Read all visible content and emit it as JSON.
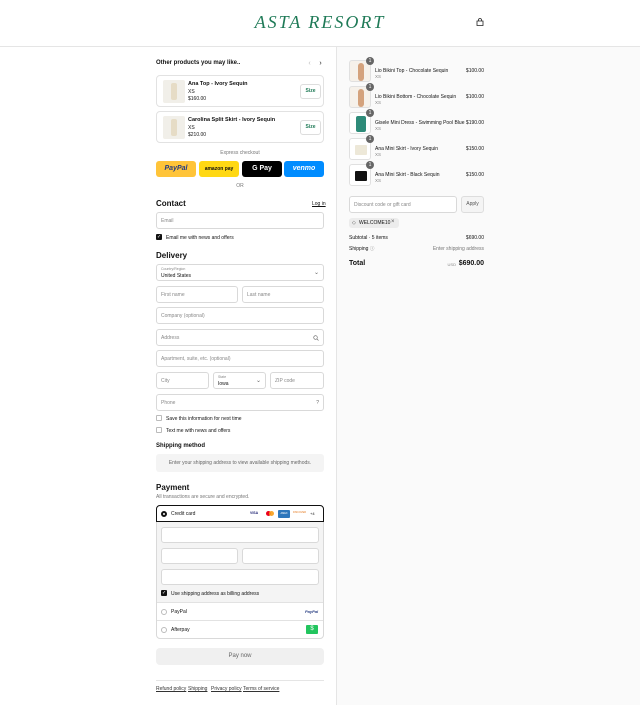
{
  "brand": "ASTA RESORT",
  "upsell": {
    "title": "Other products you may like..",
    "items": [
      {
        "name": "Ana Top - Ivory Sequin",
        "size": "XS",
        "price": "$160.00",
        "button": "Size"
      },
      {
        "name": "Carolina Split Skirt - Ivory Sequin",
        "size": "XS",
        "price": "$210.00",
        "button": "Size"
      }
    ]
  },
  "express": {
    "label": "Express checkout",
    "buttons": [
      "PayPal",
      "amazon pay",
      "G Pay",
      "venmo"
    ],
    "or": "OR"
  },
  "contact": {
    "title": "Contact",
    "login": "Log in",
    "email_placeholder": "Email",
    "newsletter": "Email me with news and offers"
  },
  "delivery": {
    "title": "Delivery",
    "country_label": "Country/Region",
    "country": "United States",
    "first_name": "First name",
    "last_name": "Last name",
    "company": "Company (optional)",
    "address": "Address",
    "apartment": "Apartment, suite, etc. (optional)",
    "city": "City",
    "state_label": "State",
    "state": "Iowa",
    "zip": "ZIP code",
    "phone": "Phone",
    "save_info": "Save this information for next time",
    "text_offers": "Text me with news and offers"
  },
  "shipping": {
    "title": "Shipping method",
    "message": "Enter your shipping address to view available shipping methods."
  },
  "payment": {
    "title": "Payment",
    "subtitle": "All transactions are secure and encrypted.",
    "credit_card": "Credit card",
    "card_brands": [
      "VISA",
      "MC",
      "AMEX",
      "DISCOVER",
      "+4"
    ],
    "billing_same": "Use shipping address as billing address",
    "paypal": "PayPal",
    "paypal_logo": "PayPal",
    "afterpay": "Afterpay",
    "pay_now": "Pay now"
  },
  "footer_links": [
    "Refund policy",
    "Shipping",
    "Privacy policy",
    "Terms of service"
  ],
  "order": {
    "items": [
      {
        "name": "Lio Bikini Top - Chocolate Sequin",
        "size": "XS",
        "price": "$100.00",
        "qty": "1"
      },
      {
        "name": "Lio Bikini Bottom - Chocolate Sequin",
        "size": "XS",
        "price": "$100.00",
        "qty": "1"
      },
      {
        "name": "Gisele Mini Dress - Swimming Pool Blue",
        "size": "XS",
        "price": "$190.00",
        "qty": "1"
      },
      {
        "name": "Ana Mini Skirt - Ivory Sequin",
        "size": "XS",
        "price": "$150.00",
        "qty": "1"
      },
      {
        "name": "Ana Mini Skirt - Black Sequin",
        "size": "XS",
        "price": "$150.00",
        "qty": "1"
      }
    ],
    "discount_placeholder": "Discount code or gift card",
    "apply": "Apply",
    "code": "WELCOME10",
    "subtotal_label": "Subtotal · 5 items",
    "subtotal": "$690.00",
    "shipping_label": "Shipping",
    "shipping_value": "Enter shipping address",
    "total_label": "Total",
    "currency": "USD",
    "total": "$690.00"
  },
  "colors": {
    "brand": "#1f7a57",
    "paypal": "#ffc439",
    "amazon": "#ffd814",
    "venmo": "#008cff"
  }
}
